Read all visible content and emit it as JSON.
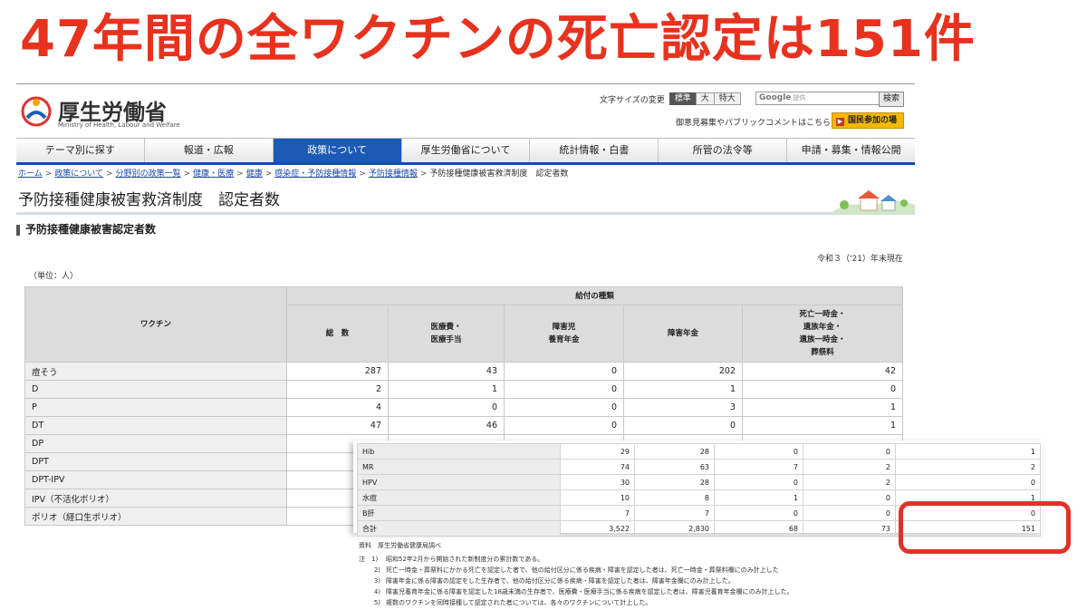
{
  "headline": "47年間の全ワクチンの死亡認定は151件",
  "header": {
    "logo_jp": "厚生労働省",
    "logo_en": "Ministry of Health, Labour and Welfare",
    "font_size_label": "文字サイズの変更",
    "font_size_options": [
      "標準",
      "大",
      "特大"
    ],
    "search_placeholder_brand": "Google",
    "search_placeholder": "提供",
    "search_button": "検索",
    "opinion_link": "御意見募集やパブリックコメントはこちら",
    "participation_button": "国民参加の場"
  },
  "nav": [
    "テーマ別に探す",
    "報道・広報",
    "政策について",
    "厚生労働省について",
    "統計情報・白書",
    "所管の法令等",
    "申請・募集・情報公開"
  ],
  "breadcrumb": {
    "links": [
      "ホーム",
      "政策について",
      "分野別の政策一覧",
      "健康・医療",
      "健康",
      "感染症・予防接種情報",
      "予防接種情報"
    ],
    "current": "予防接種健康被害救済制度　認定者数"
  },
  "page_title": "予防接種健康被害救済制度　認定者数",
  "section_heading": "予防接種健康被害認定者数",
  "date_note": "令和３（'21）年末現在",
  "unit_note": "（単位：人）",
  "table": {
    "vaccine_header": "ワクチン",
    "group_header": "給付の種類",
    "columns": [
      "総　数",
      "医療費・\n医療手当",
      "障害児\n養育年金",
      "障害年金",
      "死亡一時金・\n遺族年金・\n遺族一時金・\n葬祭料"
    ],
    "rows": [
      {
        "name": "痘そう",
        "values": [
          "287",
          "43",
          "0",
          "202",
          "42"
        ]
      },
      {
        "name": "D",
        "values": [
          "2",
          "1",
          "0",
          "1",
          "0"
        ]
      },
      {
        "name": "P",
        "values": [
          "4",
          "0",
          "0",
          "3",
          "1"
        ]
      },
      {
        "name": "DT",
        "values": [
          "47",
          "46",
          "0",
          "0",
          "1"
        ]
      },
      {
        "name": "DP",
        "values": [
          "",
          "",
          "",
          "",
          ""
        ]
      },
      {
        "name": "DPT",
        "values": [
          "",
          "",
          "",
          "",
          ""
        ]
      },
      {
        "name": "DPT-IPV",
        "values": [
          "",
          "",
          "",
          "",
          ""
        ]
      },
      {
        "name": "IPV（不活化ポリオ）",
        "values": [
          "",
          "",
          "",
          "",
          ""
        ]
      },
      {
        "name": "ポリオ（経口生ポリオ）",
        "values": [
          "",
          "",
          "",
          "",
          ""
        ]
      }
    ]
  },
  "overlay_rows": [
    {
      "name": "Hib",
      "values": [
        "29",
        "28",
        "0",
        "0",
        "1"
      ]
    },
    {
      "name": "MR",
      "values": [
        "74",
        "63",
        "7",
        "2",
        "2"
      ]
    },
    {
      "name": "HPV",
      "values": [
        "30",
        "28",
        "0",
        "2",
        "0"
      ]
    },
    {
      "name": "水痘",
      "values": [
        "10",
        "8",
        "1",
        "0",
        "1"
      ]
    },
    {
      "name": "B肝",
      "values": [
        "7",
        "7",
        "0",
        "0",
        "0"
      ]
    },
    {
      "name": "合計",
      "values": [
        "3,522",
        "2,830",
        "68",
        "73",
        "151"
      ]
    }
  ],
  "footnotes": {
    "source": "資料　厚生労働省健康局調べ",
    "notes": [
      {
        "k": "注　1)",
        "t": "昭和52年2月から開始された新制度分の累計数である。"
      },
      {
        "k": "2)",
        "t": "死亡一時金・葬祭料にかかる死亡を認定した者で、他の給付区分に係る疾病・障害を認定した者は、死亡一時金・葬祭料欄にのみ計上した"
      },
      {
        "k": "3)",
        "t": "障害年金に係る障害の認定をした生存者で、他の給付区分に係る疾病・障害を認定した者は、障害年金欄にのみ計上した。"
      },
      {
        "k": "4)",
        "t": "障害児養育年金に係る障害を認定した18歳未満の生存者で、医療費・医療手当に係る疾病を認定した者は、障害児養育年金欄にのみ計上した。"
      },
      {
        "k": "5)",
        "t": "複数のワクチンを同時接種して認定された者については、各々のワクチンについて計上した。"
      }
    ]
  },
  "colors": {
    "headline": "#e8321e",
    "nav_active": "#1c5ab5",
    "highlight": "#e23127",
    "participation": "#f3b800"
  }
}
